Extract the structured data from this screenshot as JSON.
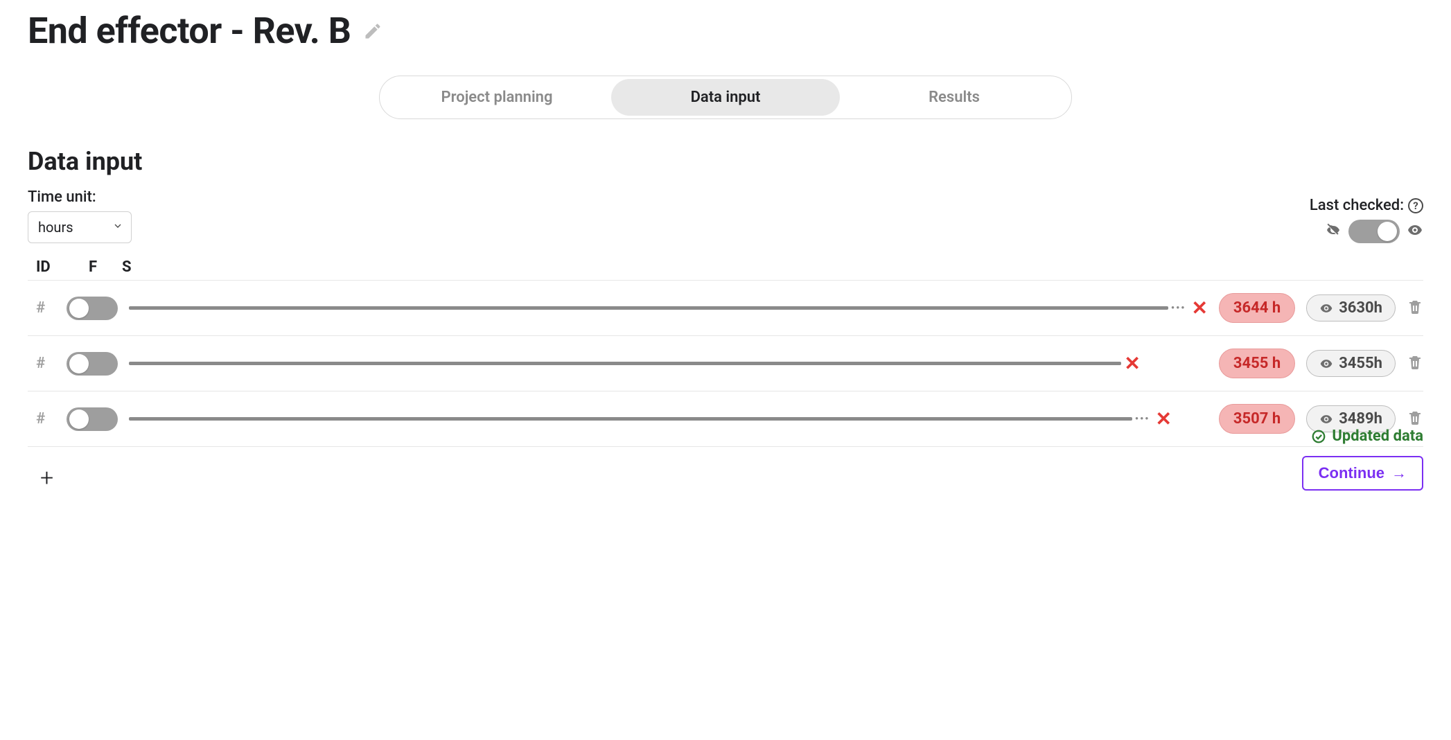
{
  "page": {
    "title": "End effector - Rev. B"
  },
  "tabs": [
    {
      "label": "Project planning",
      "active": false
    },
    {
      "label": "Data input",
      "active": true
    },
    {
      "label": "Results",
      "active": false
    }
  ],
  "section": {
    "title": "Data input"
  },
  "time_unit": {
    "label": "Time unit:",
    "selected": "hours"
  },
  "last_checked": {
    "label": "Last checked:",
    "toggle_on": true
  },
  "columns": {
    "id": "ID",
    "f": "F",
    "s": "S"
  },
  "rows": [
    {
      "id_placeholder": "#",
      "toggle_on": false,
      "truncated": true,
      "fail_label": "3644 h",
      "checked_label": "3630h",
      "track_fraction": 0.97
    },
    {
      "id_placeholder": "#",
      "toggle_on": false,
      "truncated": false,
      "fail_label": "3455 h",
      "checked_label": "3455h",
      "track_fraction": 0.92
    },
    {
      "id_placeholder": "#",
      "toggle_on": false,
      "truncated": true,
      "fail_label": "3507 h",
      "checked_label": "3489h",
      "track_fraction": 0.925
    }
  ],
  "status": {
    "updated_label": "Updated data"
  },
  "actions": {
    "continue_label": "Continue"
  }
}
